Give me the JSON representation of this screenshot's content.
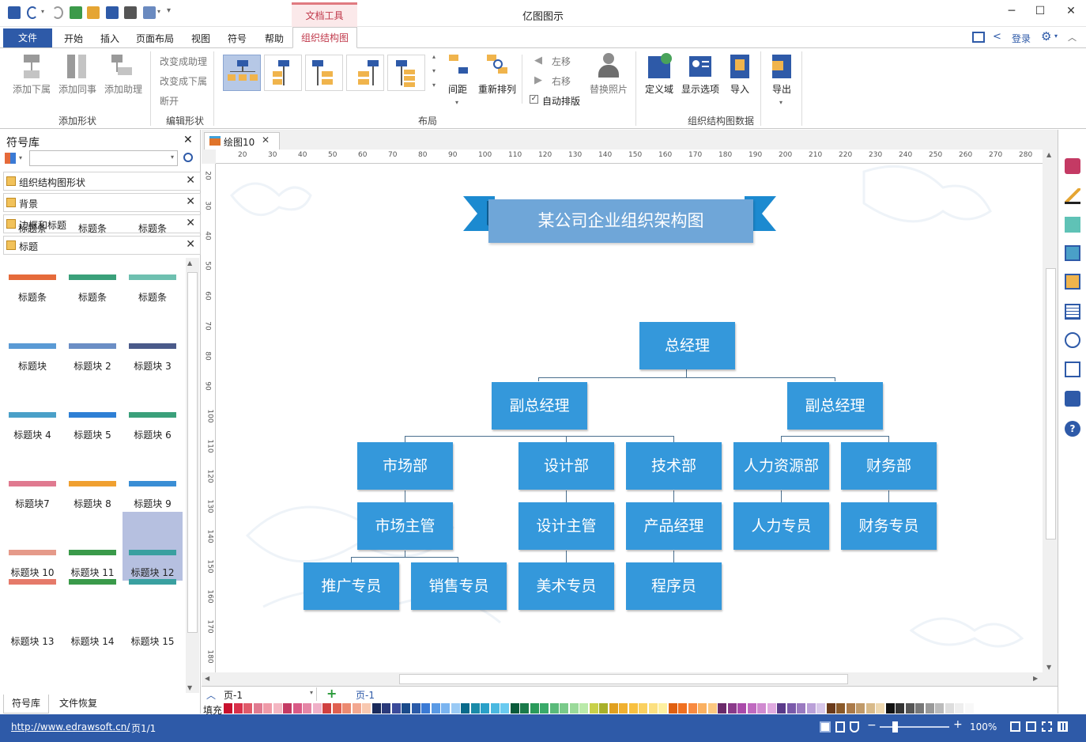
{
  "app": {
    "title": "亿图图示",
    "context_tab": "文档工具"
  },
  "window": {
    "minimize": "─",
    "maximize": "☐",
    "close": "✕"
  },
  "menu": {
    "file": "文件",
    "items": [
      "开始",
      "插入",
      "页面布局",
      "视图",
      "符号",
      "帮助"
    ],
    "active": "组织结构图",
    "login": "登录"
  },
  "ribbon": {
    "add_shape": {
      "items": [
        "添加下属",
        "添加同事",
        "添加助理"
      ],
      "label": "添加形状"
    },
    "edit_shape": {
      "items": [
        "改变成助理",
        "改变成下属",
        "断开"
      ],
      "label": "编辑形状"
    },
    "layout": {
      "spacing": "间距",
      "rearrange": "重新排列",
      "move_left": "左移",
      "move_right": "右移",
      "auto_layout": "自动排版",
      "replace_photo": "替换照片",
      "label": "布局"
    },
    "org_data": {
      "define": "定义域",
      "display": "显示选项",
      "import": "导入",
      "export": "导出",
      "label": "组织结构图数据"
    }
  },
  "symbol_panel": {
    "title": "符号库",
    "close": "✕",
    "libraries": [
      "组织结构图形状",
      "背景",
      "边框和标题",
      "标题"
    ],
    "cells": [
      [
        "标题条",
        "标题条",
        "标题条"
      ],
      [
        "标题条",
        "标题条",
        "标题条"
      ],
      [
        "标题块",
        "标题块 2",
        "标题块 3"
      ],
      [
        "标题块 4",
        "标题块 5",
        "标题块 6"
      ],
      [
        "标题块7",
        "标题块 8",
        "标题块 9"
      ],
      [
        "标题块 10",
        "标题块 11",
        "标题块 12"
      ],
      [
        "标题块 13",
        "标题块 14",
        "标题块 15"
      ]
    ],
    "tabs": [
      "符号库",
      "文件恢复"
    ]
  },
  "document": {
    "tab": "绘图10",
    "tab_close": "✕",
    "ruler_h": [
      "20",
      "30",
      "40",
      "50",
      "60",
      "70",
      "80",
      "90",
      "100",
      "110",
      "120",
      "130",
      "140",
      "150",
      "160",
      "170",
      "180",
      "190",
      "200",
      "210",
      "220",
      "230",
      "240",
      "250",
      "260",
      "270",
      "280"
    ],
    "ruler_v": [
      "20",
      "30",
      "40",
      "50",
      "60",
      "70",
      "80",
      "90",
      "100",
      "110",
      "120",
      "130",
      "140",
      "150",
      "160",
      "170",
      "180"
    ]
  },
  "org_chart": {
    "title": "某公司企业组织架构图",
    "ceo": "总经理",
    "vp_left": "副总经理",
    "vp_right": "副总经理",
    "departments": [
      "市场部",
      "设计部",
      "技术部",
      "人力资源部",
      "财务部"
    ],
    "managers": [
      "市场主管",
      "设计主管",
      "产品经理",
      "人力专员",
      "财务专员"
    ],
    "staff": [
      "推广专员",
      "销售专员",
      "美术专员",
      "程序员"
    ],
    "colors": {
      "box": "#3498db",
      "title_box": "#6fa6d8",
      "ribbon": "#1c8ad0",
      "connector": "#4a6f8e"
    }
  },
  "page_bar": {
    "page_select": "页-1",
    "add": "+",
    "current_page": "页-1"
  },
  "palette": {
    "label": "填充"
  },
  "status": {
    "url": "http://www.edrawsoft.cn/",
    "page_info": "页1/1",
    "zoom": "100%"
  }
}
